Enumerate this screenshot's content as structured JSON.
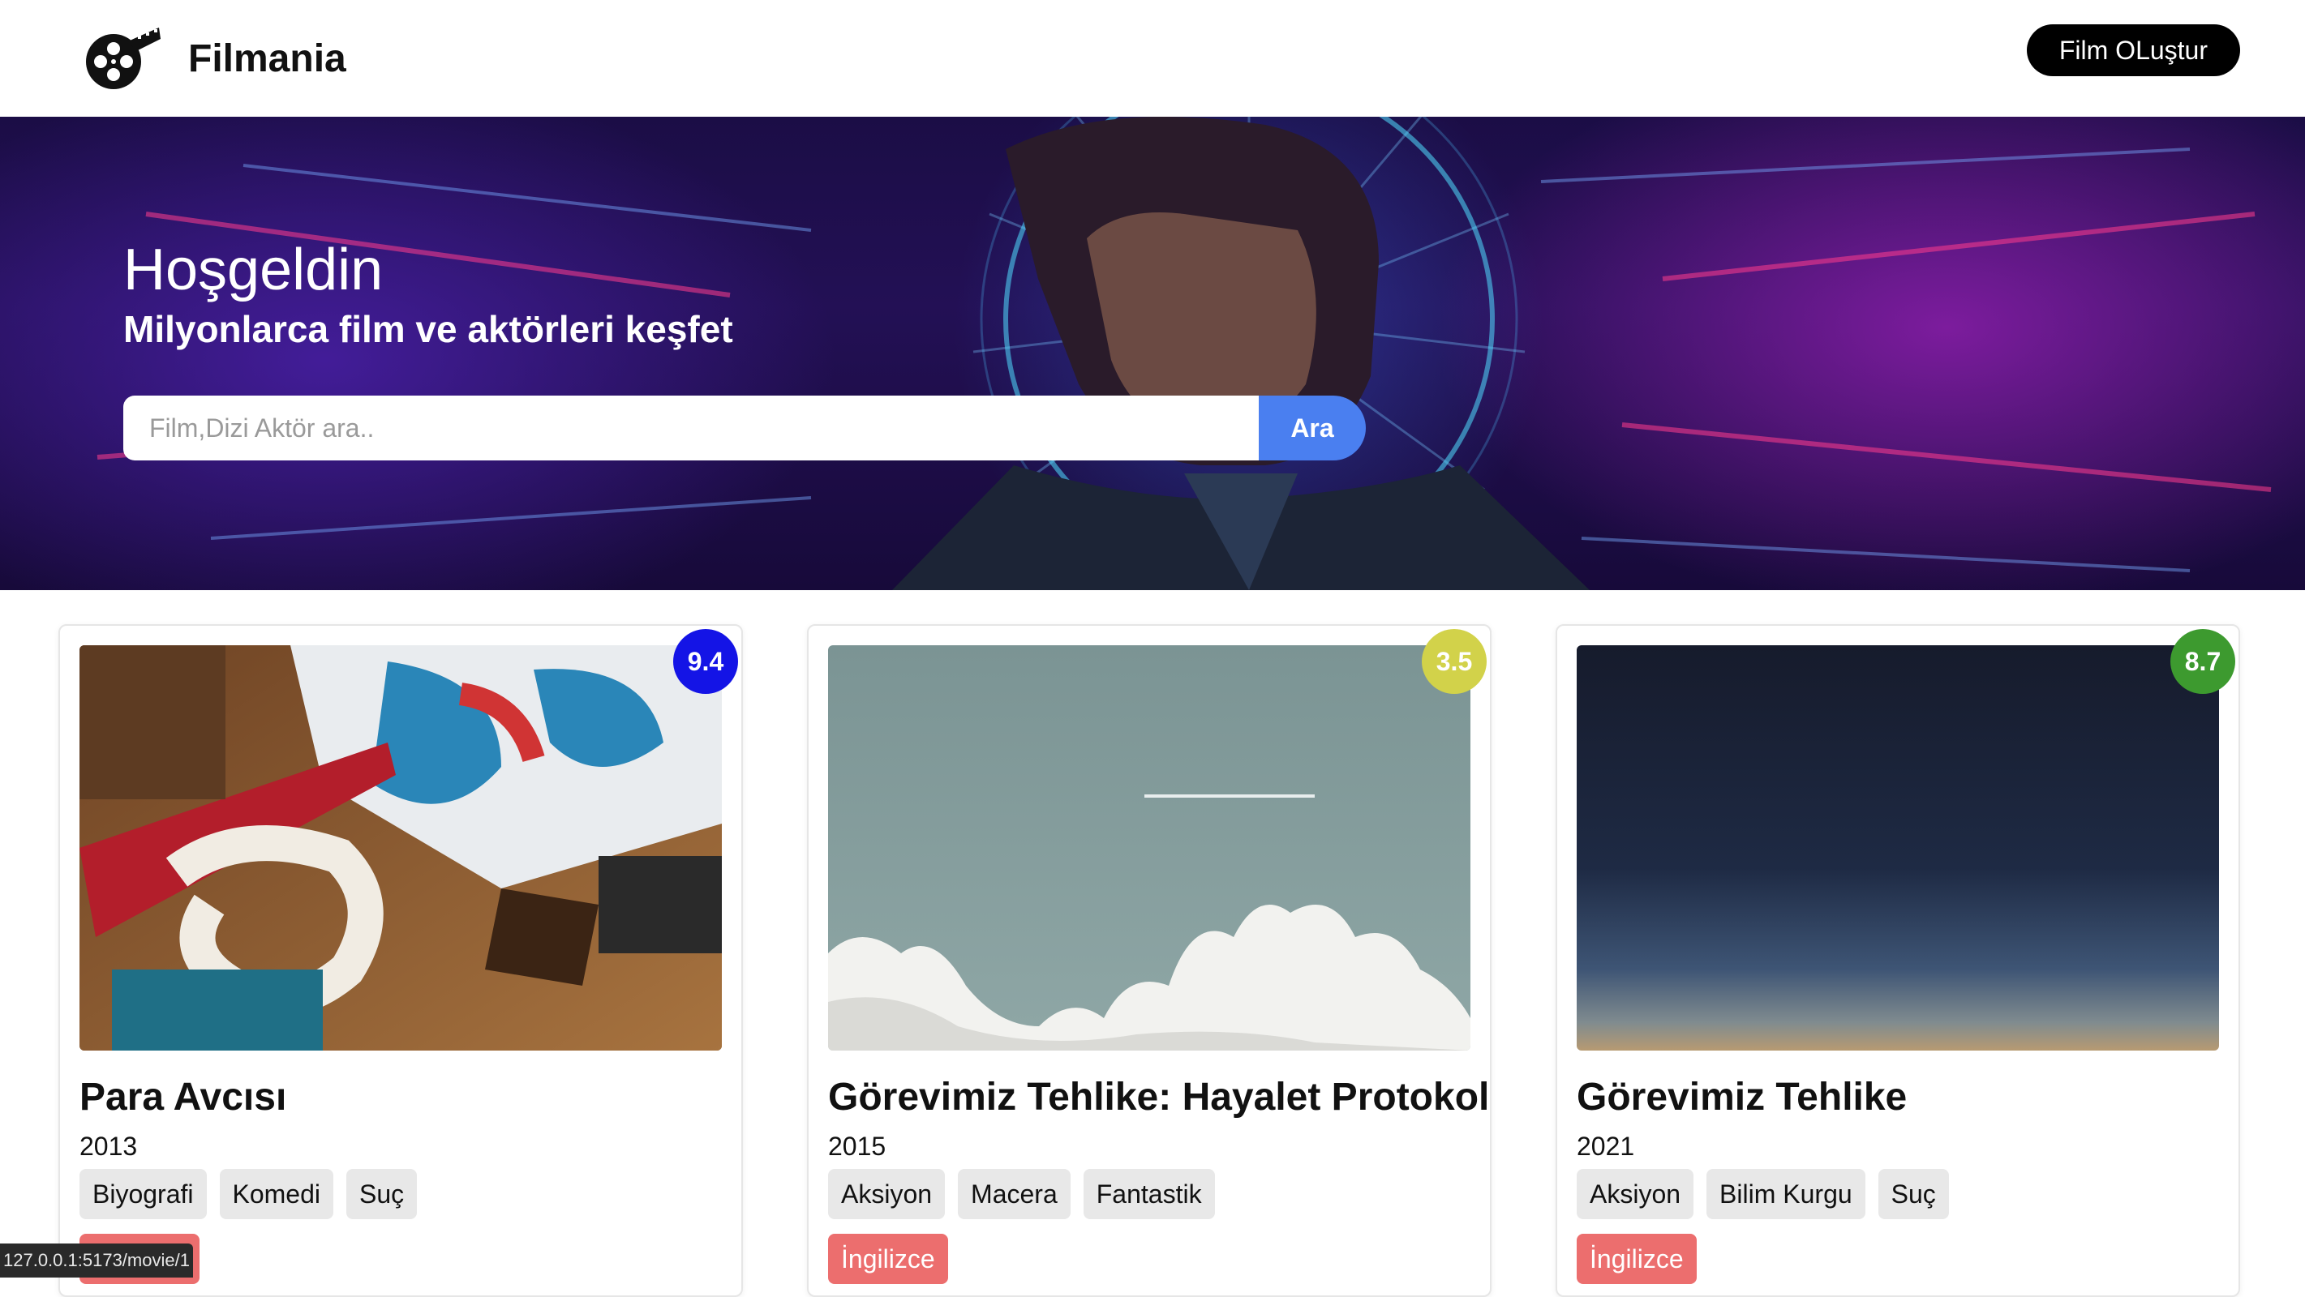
{
  "header": {
    "brand": "Filmania",
    "create_button": "Film OLuştur"
  },
  "hero": {
    "title": "Hoşgeldin",
    "subtitle": "Milyonlarca film ve aktörleri keşfet",
    "search_placeholder": "Film,Dizi Aktör ara..",
    "search_button": "Ara"
  },
  "movies": [
    {
      "title": "Para Avcısı",
      "year": "2013",
      "rating": "9.4",
      "rating_color": "#1414e6",
      "genres": [
        "Biyografi",
        "Komedi",
        "Suç"
      ],
      "language": "İngilizce"
    },
    {
      "title": "Görevimiz Tehlike: Hayalet Protokol",
      "year": "2015",
      "rating": "3.5",
      "rating_color": "#d2d24a",
      "genres": [
        "Aksiyon",
        "Macera",
        "Fantastik"
      ],
      "language": "İngilizce"
    },
    {
      "title": "Görevimiz Tehlike",
      "year": "2021",
      "rating": "8.7",
      "rating_color": "#3d9a2f",
      "genres": [
        "Aksiyon",
        "Bilim Kurgu",
        "Suç"
      ],
      "language": "İngilizce"
    }
  ],
  "status_bar": {
    "url": "127.0.0.1:5173/movie/1"
  }
}
